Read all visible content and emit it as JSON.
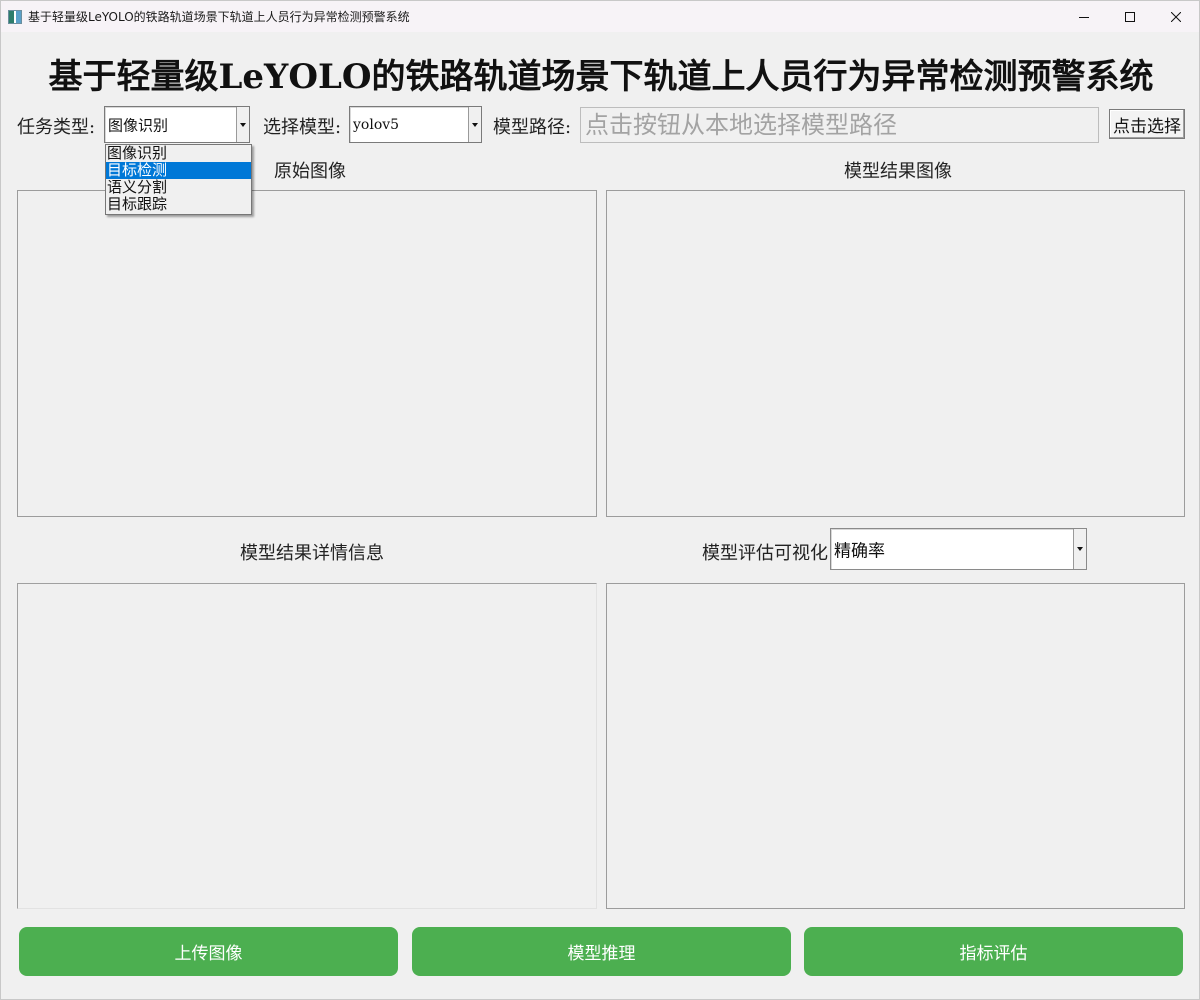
{
  "window": {
    "title": "基于轻量级LeYOLO的铁路轨道场景下轨道上人员行为异常检测预警系统",
    "icon": "app-icon",
    "controls": {
      "minimize_icon": "minimize-icon",
      "maximize_icon": "maximize-icon",
      "close_icon": "close-icon"
    }
  },
  "header": {
    "title": "基于轻量级LeYOLO的铁路轨道场景下轨道上人员行为异常检测预警系统"
  },
  "toolbar": {
    "task_label": "任务类型:",
    "task_value": "图像识别",
    "task_options": [
      "图像识别",
      "目标检测",
      "语义分割",
      "目标跟踪"
    ],
    "task_highlighted_index": 1,
    "model_label": "选择模型:",
    "model_value": "yolov5",
    "path_label": "模型路径:",
    "path_placeholder": "点击按钮从本地选择模型路径",
    "path_value": "",
    "choose_button": "点击选择"
  },
  "panels": {
    "original_title": "原始图像",
    "result_title": "模型结果图像",
    "details_title": "模型结果详情信息",
    "eval_title": "模型评估可视化",
    "eval_metric_value": "精确率"
  },
  "actions": {
    "upload": "上传图像",
    "infer": "模型推理",
    "evaluate": "指标评估"
  },
  "colors": {
    "action_button": "#4caf50",
    "selection_highlight": "#0078d7",
    "window_background": "#f0f0f0"
  }
}
